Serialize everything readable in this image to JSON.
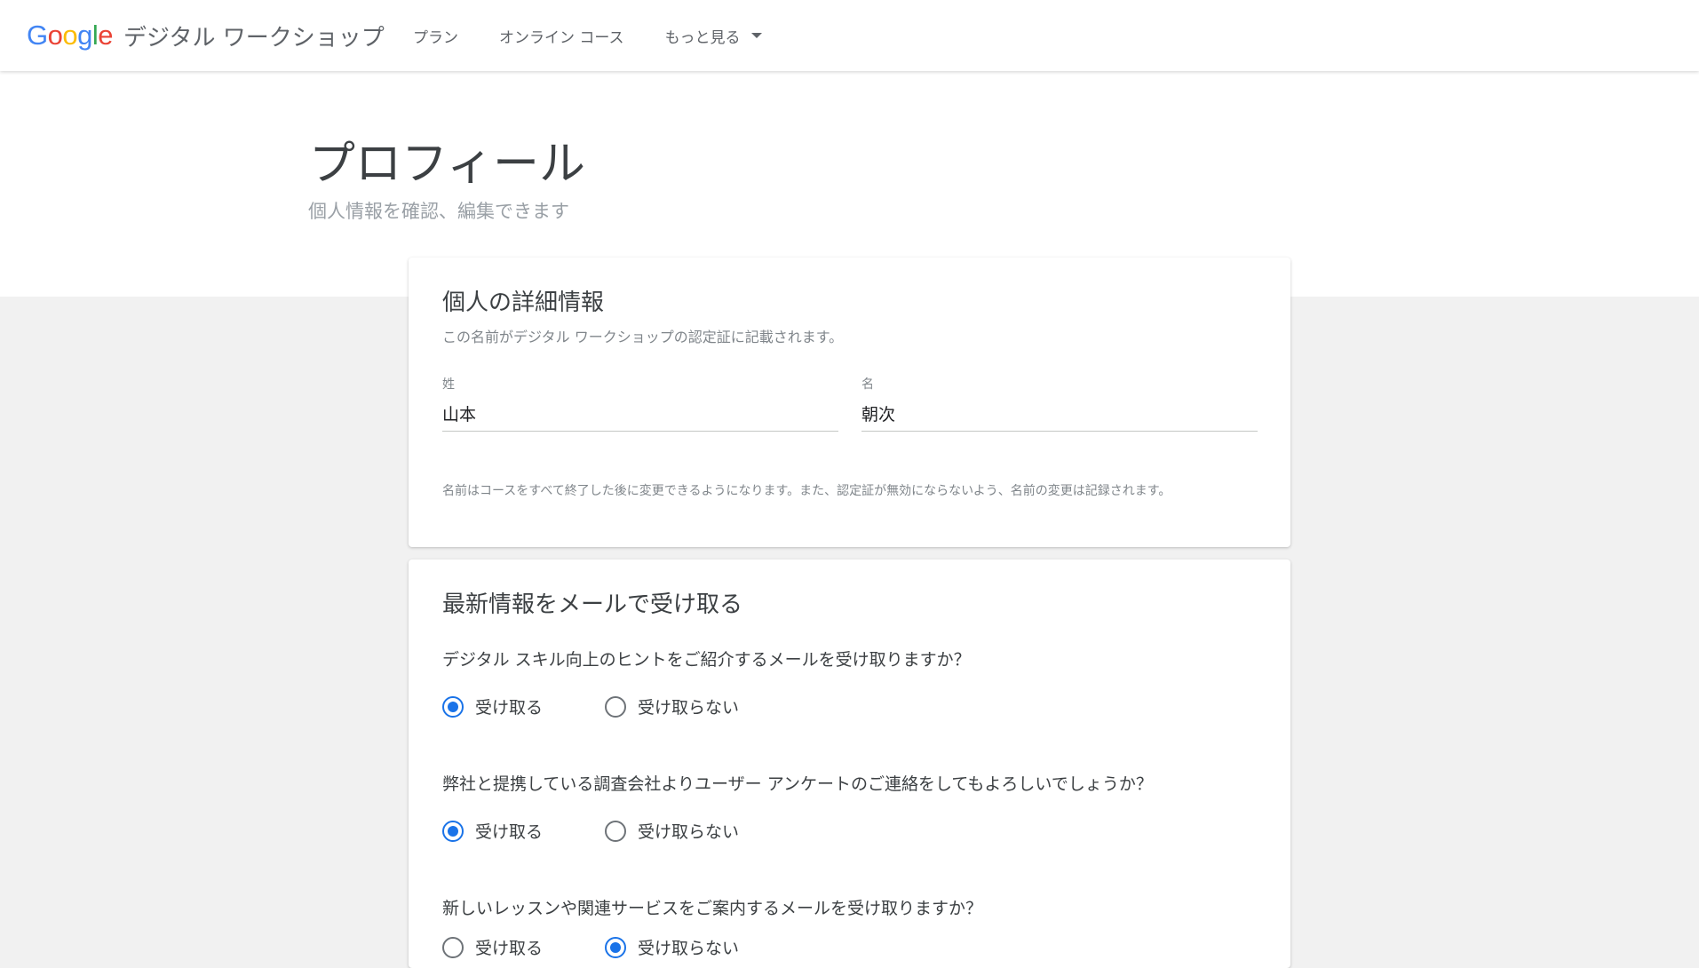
{
  "header": {
    "logo_letters": [
      "G",
      "o",
      "o",
      "g",
      "l",
      "e"
    ],
    "logo_colors": [
      "#4285F4",
      "#EA4335",
      "#FBBC05",
      "#4285F4",
      "#34A853",
      "#EA4335"
    ],
    "product_name": "デジタル ワークショップ",
    "nav": [
      {
        "label": "プラン"
      },
      {
        "label": "オンライン コース"
      },
      {
        "label": "もっと見る",
        "icon": "chevron-down-icon"
      }
    ]
  },
  "hero": {
    "title": "プロフィール",
    "subtitle": "個人情報を確認、編集できます"
  },
  "personal_details": {
    "title": "個人の詳細情報",
    "description": "この名前がデジタル ワークショップの認定証に記載されます。",
    "last_name_label": "姓",
    "last_name_value": "山本",
    "first_name_label": "名",
    "first_name_value": "朝次",
    "note": "名前はコースをすべて終了した後に変更できるようになります。また、認定証が無効にならないよう、名前の変更は記録されます。"
  },
  "email_updates": {
    "title": "最新情報をメールで受け取る",
    "questions": [
      {
        "text": "デジタル スキル向上のヒントをご紹介するメールを受け取りますか？",
        "options": [
          "受け取る",
          "受け取らない"
        ],
        "selected": 0
      },
      {
        "text": "弊社と提携している調査会社よりユーザー アンケートのご連絡をしてもよろしいでしょうか？",
        "options": [
          "受け取る",
          "受け取らない"
        ],
        "selected": 0
      },
      {
        "text": "新しいレッスンや関連サービスをご案内するメールを受け取りますか？",
        "options": [
          "受け取る",
          "受け取らない"
        ],
        "selected": 1
      }
    ]
  },
  "colors": {
    "accent": "#1a73e8",
    "page_background": "#f1f1f1"
  }
}
